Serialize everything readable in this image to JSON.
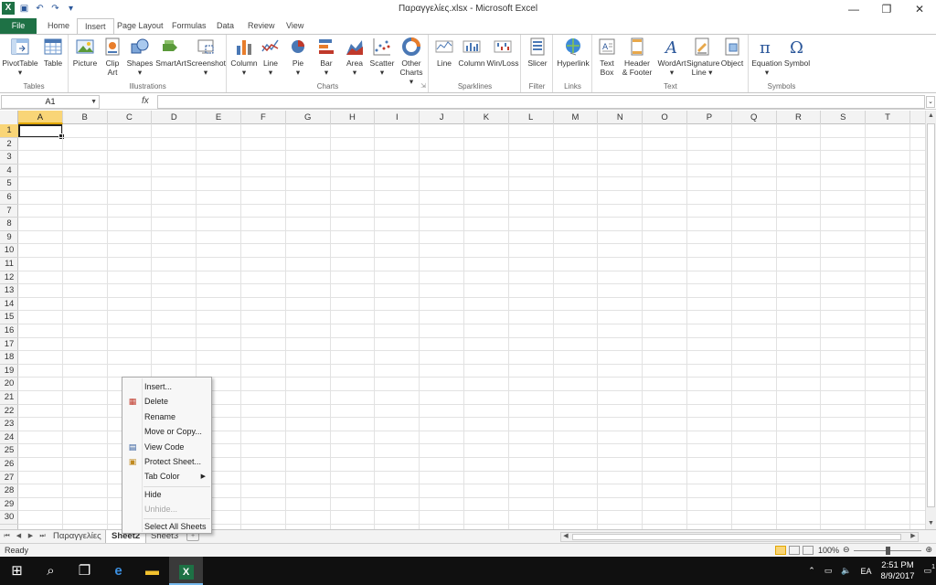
{
  "window": {
    "title": "Παραγγελίες.xlsx - Microsoft Excel",
    "controls": [
      "minimize",
      "restore",
      "close"
    ]
  },
  "ribbon_tabs": [
    "File",
    "Home",
    "Insert",
    "Page Layout",
    "Formulas",
    "Data",
    "Review",
    "View"
  ],
  "active_tab": "Insert",
  "ribbon_groups": [
    {
      "label": "Tables",
      "buttons": [
        {
          "l1": "PivotTable",
          "l2": "▾"
        },
        {
          "l1": "Table",
          "l2": ""
        }
      ]
    },
    {
      "label": "Illustrations",
      "buttons": [
        {
          "l1": "Picture",
          "l2": ""
        },
        {
          "l1": "Clip",
          "l2": "Art"
        },
        {
          "l1": "Shapes",
          "l2": "▾"
        },
        {
          "l1": "SmartArt",
          "l2": ""
        },
        {
          "l1": "Screenshot",
          "l2": "▾"
        }
      ]
    },
    {
      "label": "Charts",
      "buttons": [
        {
          "l1": "Column",
          "l2": "▾"
        },
        {
          "l1": "Line",
          "l2": "▾"
        },
        {
          "l1": "Pie",
          "l2": "▾"
        },
        {
          "l1": "Bar",
          "l2": "▾"
        },
        {
          "l1": "Area",
          "l2": "▾"
        },
        {
          "l1": "Scatter",
          "l2": "▾"
        },
        {
          "l1": "Other",
          "l2": "Charts ▾"
        }
      ]
    },
    {
      "label": "Sparklines",
      "buttons": [
        {
          "l1": "Line",
          "l2": ""
        },
        {
          "l1": "Column",
          "l2": ""
        },
        {
          "l1": "Win/Loss",
          "l2": ""
        }
      ]
    },
    {
      "label": "Filter",
      "buttons": [
        {
          "l1": "Slicer",
          "l2": ""
        }
      ]
    },
    {
      "label": "Links",
      "buttons": [
        {
          "l1": "Hyperlink",
          "l2": ""
        }
      ]
    },
    {
      "label": "Text",
      "buttons": [
        {
          "l1": "Text",
          "l2": "Box"
        },
        {
          "l1": "Header",
          "l2": "& Footer"
        },
        {
          "l1": "WordArt",
          "l2": "▾"
        },
        {
          "l1": "Signature",
          "l2": "Line ▾"
        },
        {
          "l1": "Object",
          "l2": ""
        }
      ]
    },
    {
      "label": "Symbols",
      "buttons": [
        {
          "l1": "Equation",
          "l2": "▾"
        },
        {
          "l1": "Symbol",
          "l2": ""
        }
      ]
    }
  ],
  "formula_bar": {
    "name_box": "A1",
    "fx": "fx",
    "formula": ""
  },
  "columns": [
    "A",
    "B",
    "C",
    "D",
    "E",
    "F",
    "G",
    "H",
    "I",
    "J",
    "K",
    "L",
    "M",
    "N",
    "O",
    "P",
    "Q",
    "R",
    "S",
    "T"
  ],
  "rows": [
    "1",
    "2",
    "3",
    "4",
    "5",
    "6",
    "7",
    "8",
    "9",
    "10",
    "11",
    "12",
    "13",
    "14",
    "15",
    "16",
    "17",
    "18",
    "19",
    "20",
    "21",
    "22",
    "23",
    "24",
    "25",
    "26",
    "27",
    "28",
    "29",
    "30"
  ],
  "active_cell": "A1",
  "context_menu": {
    "items": [
      {
        "label": "Insert...",
        "icon": "",
        "enabled": true
      },
      {
        "label": "Delete",
        "icon": "delete-sheet-icon",
        "enabled": true
      },
      {
        "label": "Rename",
        "icon": "",
        "enabled": true
      },
      {
        "label": "Move or Copy...",
        "icon": "",
        "enabled": true
      },
      {
        "label": "View Code",
        "icon": "view-code-icon",
        "enabled": true
      },
      {
        "label": "Protect Sheet...",
        "icon": "protect-sheet-icon",
        "enabled": true
      },
      {
        "label": "Tab Color",
        "icon": "",
        "enabled": true,
        "submenu": true
      },
      {
        "label": "Hide",
        "icon": "",
        "enabled": true
      },
      {
        "label": "Unhide...",
        "icon": "",
        "enabled": false
      },
      {
        "label": "Select All Sheets",
        "icon": "",
        "enabled": true
      }
    ]
  },
  "sheets": [
    "Παραγγελίες",
    "Sheet2",
    "Sheet3"
  ],
  "active_sheet": "Sheet2",
  "status": {
    "text": "Ready",
    "zoom": "100%"
  },
  "taskbar": {
    "language": "EA",
    "time": "2:51 PM",
    "date": "8/9/2017",
    "notifications": "1"
  },
  "colors": {
    "excel_green": "#1e7145",
    "selected_header": "#f9d577",
    "accent_blue": "#2b579a"
  }
}
